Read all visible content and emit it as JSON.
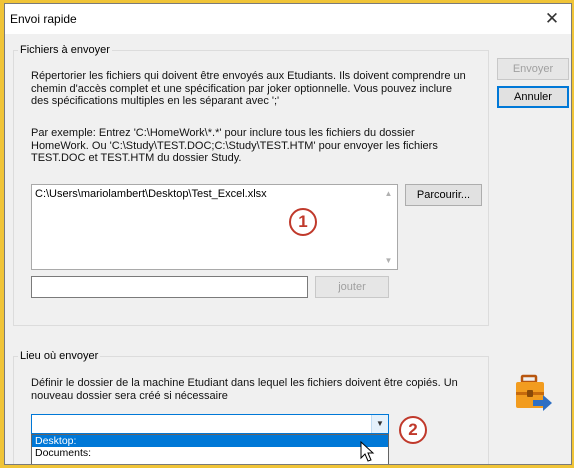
{
  "window": {
    "title": "Envoi rapide",
    "close_glyph": "✕"
  },
  "files_group": {
    "legend": "Fichiers à envoyer",
    "description": "Répertorier les fichiers qui doivent être envoyés aux Etudiants. Ils doivent comprendre un chemin d'accès complet et une spécification par joker optionnelle. Vous pouvez inclure des spécifications multiples en les séparant avec ';'",
    "example": "Par exemple: Entrez 'C:\\HomeWork\\*.*' pour inclure tous les fichiers du dossier HomeWork. Ou 'C:\\Study\\TEST.DOC;C:\\Study\\TEST.HTM' pour envoyer les fichiers TEST.DOC et TEST.HTM du dossier Study.",
    "list_items": [
      "C:\\Users\\mariolambert\\Desktop\\Test_Excel.xlsx"
    ],
    "browse_label": "Parcourir...",
    "add_input_value": "",
    "add_label": "jouter"
  },
  "dest_group": {
    "legend": "Lieu où envoyer",
    "description": "Définir le dossier de la machine Etudiant dans lequel les fichiers doivent être copiés. Un nouveau dossier sera créé si nécessaire",
    "combo_value": "",
    "options": [
      "Desktop:",
      "Documents:"
    ],
    "selected_option": "Desktop:"
  },
  "actions": {
    "send_label": "Envoyer",
    "cancel_label": "Annuler"
  },
  "annotations": {
    "marker1": "1",
    "marker2": "2",
    "marker_color": "#c0392b"
  },
  "icons": {
    "close": "close-icon",
    "scroll_up": "scroll-up-icon",
    "scroll_down": "scroll-down-icon",
    "dropdown": "chevron-down-icon",
    "send_files": "briefcase-send-icon",
    "cursor": "mouse-pointer-icon"
  },
  "colors": {
    "accent": "#0078d7",
    "frame": "#f0c437",
    "dialog_bg": "#f0f0f0"
  }
}
